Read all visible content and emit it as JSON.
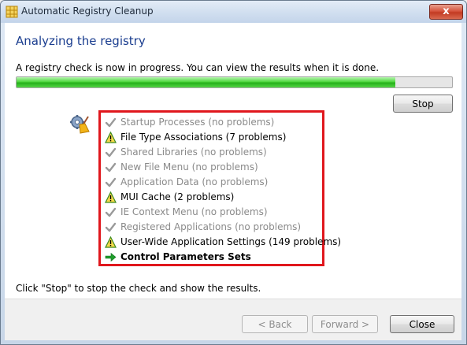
{
  "window": {
    "title": "Automatic Registry Cleanup",
    "close_glyph": "x",
    "app_icon": "registry-grid-icon"
  },
  "main": {
    "heading": "Analyzing the registry",
    "description": "A registry check is now in progress. You can view the results when it is done.",
    "progress_fraction": 0.87,
    "progress_color": "#26b01a",
    "stop_label": "Stop",
    "scan_icon": "gear-broom-icon",
    "checklist_border_color": "#e0171d",
    "checks": [
      {
        "label": "Startup Processes (no problems)",
        "status": "ok"
      },
      {
        "label": "File Type Associations (7 problems)",
        "status": "warning"
      },
      {
        "label": "Shared Libraries (no problems)",
        "status": "ok"
      },
      {
        "label": "New File Menu (no problems)",
        "status": "ok"
      },
      {
        "label": "Application Data (no problems)",
        "status": "ok"
      },
      {
        "label": "MUI Cache (2 problems)",
        "status": "warning"
      },
      {
        "label": "IE Context Menu (no problems)",
        "status": "ok"
      },
      {
        "label": "Registered Applications (no problems)",
        "status": "ok"
      },
      {
        "label": "User-Wide Application Settings (149 problems)",
        "status": "warning"
      },
      {
        "label": "Control Parameters Sets",
        "status": "in-progress"
      }
    ],
    "hint": "Click \"Stop\" to stop the check and show the results."
  },
  "footer": {
    "back_label": "< Back",
    "forward_label": "Forward >",
    "close_label": "Close"
  }
}
